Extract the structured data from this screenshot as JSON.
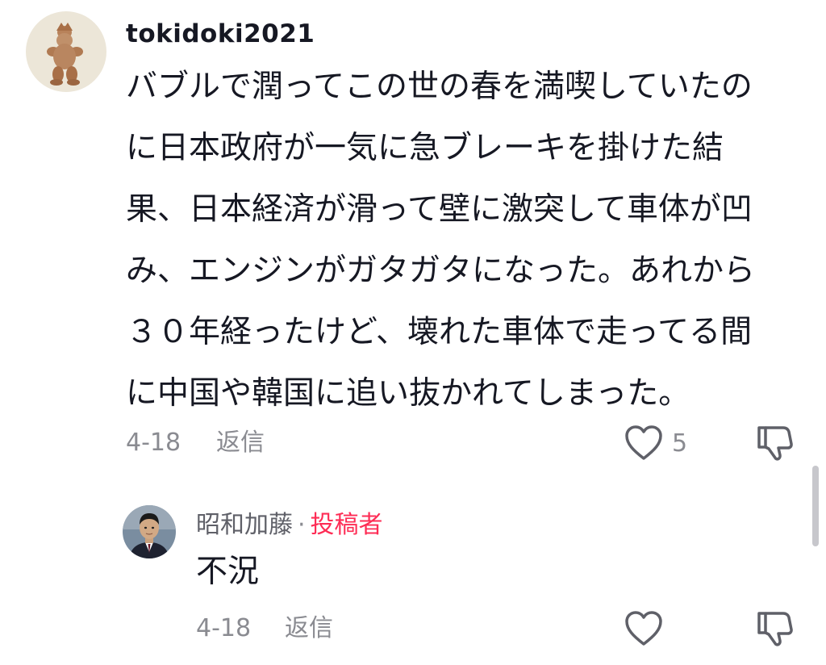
{
  "comment": {
    "username": "tokidoki2021",
    "lines": [
      "バブルで潤ってこの世の春を満喫していたの",
      "に日本政府が一気に急ブレーキを掛けた結",
      "果、日本経済が滑って壁に激突して車体が凹",
      "み、エンジンがガタガタになった。あれから",
      "３０年経ったけど、壊れた車体で走ってる間",
      "に中国や韓国に追い抜かれてしまった。"
    ],
    "date": "4-18",
    "reply_label": "返信",
    "like_count": "5",
    "icons": {
      "avatar": "clay-figurine-avatar",
      "like": "heart-icon",
      "dislike": "thumbs-down-icon"
    }
  },
  "reply": {
    "username": "昭和加藤",
    "separator": "·",
    "author_badge": "投稿者",
    "text": "不況",
    "date": "4-18",
    "reply_label": "返信",
    "icons": {
      "avatar": "man-in-suit-avatar",
      "like": "heart-icon",
      "dislike": "thumbs-down-icon"
    }
  },
  "colors": {
    "text_primary": "#161823",
    "text_secondary": "#8a8b91",
    "author_badge": "#fe2c55",
    "scrollbar": "#c7c7cc"
  }
}
